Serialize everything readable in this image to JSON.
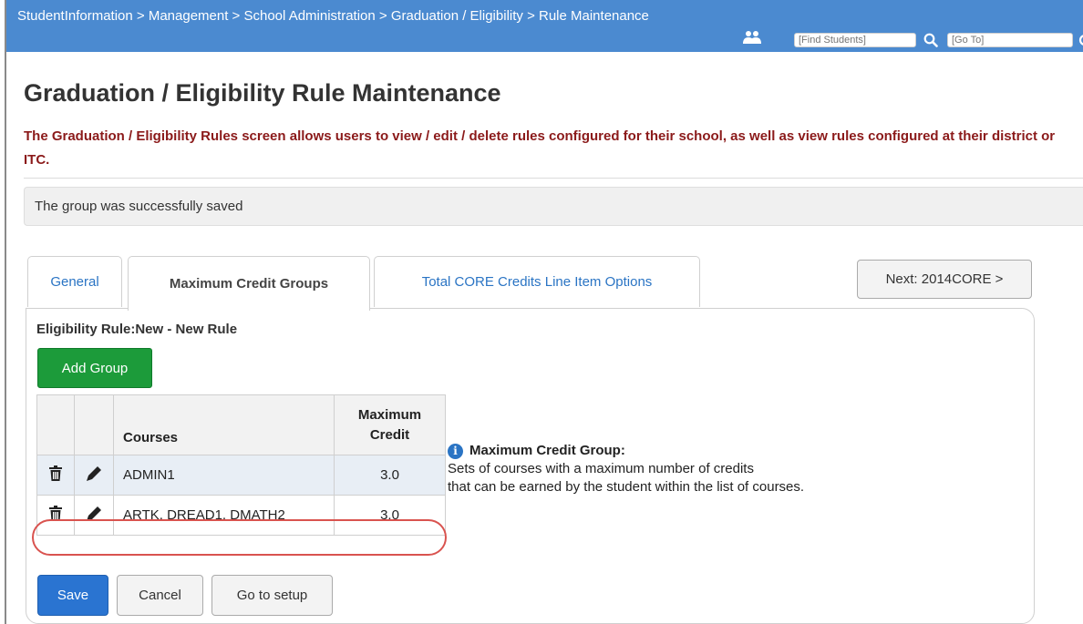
{
  "header": {
    "breadcrumb": "StudentInformation > Management > School Administration > Graduation / Eligibility > Rule Maintenance",
    "find_placeholder": "[Find Students]",
    "goto_placeholder": "[Go To]",
    "bar_color": "#4b8ad0"
  },
  "page": {
    "title": "Graduation / Eligibility Rule Maintenance",
    "description": "The Graduation / Eligibility Rules screen allows users to view / edit / delete rules configured for their school, as well as view rules configured at their district or ITC.",
    "status": "The group was successfully saved"
  },
  "tabs": [
    {
      "label": "General",
      "active": false
    },
    {
      "label": "Maximum Credit Groups",
      "active": true
    },
    {
      "label": "Total CORE Credits Line Item Options",
      "active": false
    }
  ],
  "next_button": "Next: 2014CORE >",
  "panel": {
    "rule_prefix": "Eligibility Rule:",
    "rule_name": "New - New Rule",
    "add_group_label": "Add Group",
    "table": {
      "headers": {
        "courses": "Courses",
        "max_credit_line1": "Maximum",
        "max_credit_line2": "Credit"
      },
      "rows": [
        {
          "courses": "ADMIN1",
          "max_credit": "3.0"
        },
        {
          "courses": "ARTK, DREAD1, DMATH2",
          "max_credit": "3.0"
        }
      ]
    },
    "info": {
      "title": "Maximum Credit Group:",
      "line1": "Sets of courses with a maximum number of credits",
      "line2": "that can be earned by the student within the list of courses."
    },
    "buttons": {
      "save": "Save",
      "cancel": "Cancel",
      "setup": "Go to setup"
    }
  },
  "colors": {
    "description_text": "#8b1a1a",
    "add_group": "#1c9b3a",
    "save": "#2a74d1",
    "highlight": "#d9534f",
    "link": "#2a74c4"
  }
}
